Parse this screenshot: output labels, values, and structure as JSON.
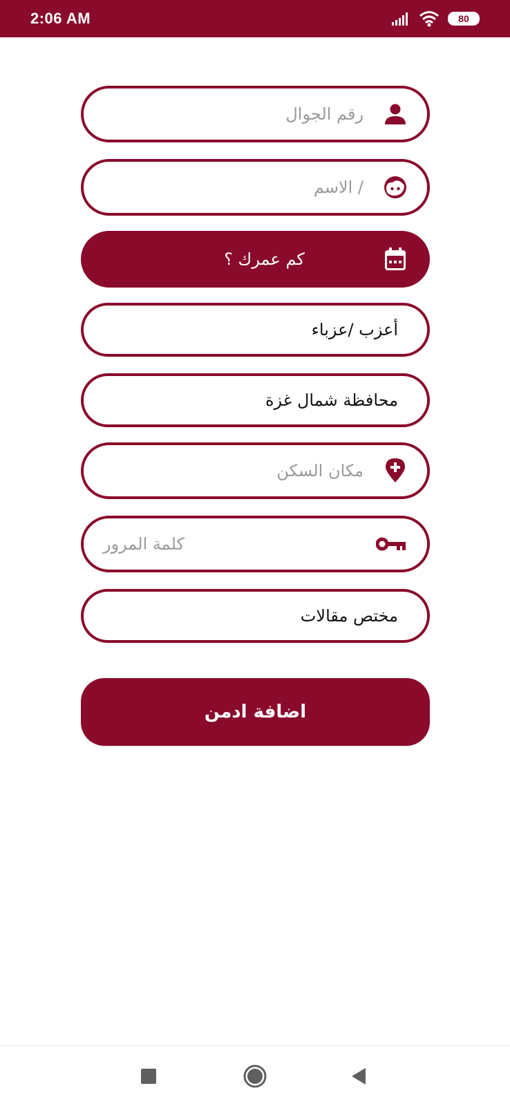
{
  "status_bar": {
    "time": "2:06 AM",
    "battery": "80",
    "icons": [
      "signal-icon",
      "wifi-icon",
      "battery-icon"
    ]
  },
  "form": {
    "phone": {
      "placeholder": "رقم الجوال",
      "icon": "user-icon"
    },
    "name": {
      "placeholder": "/ الاسم",
      "icon": "face-icon"
    },
    "age": {
      "label": "كم عمرك ؟",
      "icon": "calendar-icon"
    },
    "marital_status": {
      "value": "أعزب /عزباء"
    },
    "governorate": {
      "value": "محافظة شمال غزة"
    },
    "residence": {
      "placeholder": "مكان السكن",
      "icon": "location-plus-icon"
    },
    "password": {
      "placeholder": "كلمة المرور",
      "icon": "key-icon"
    },
    "specialty": {
      "value": "مختص مقالات"
    }
  },
  "submit_label": "اضافة ادمن",
  "colors": {
    "primary": "#8a0a2b",
    "placeholder": "#9a9a9a",
    "text": "#111111",
    "background": "#ffffff"
  },
  "nav_bar": {
    "icons": [
      "recents-square-icon",
      "home-circle-icon",
      "back-triangle-icon"
    ]
  }
}
